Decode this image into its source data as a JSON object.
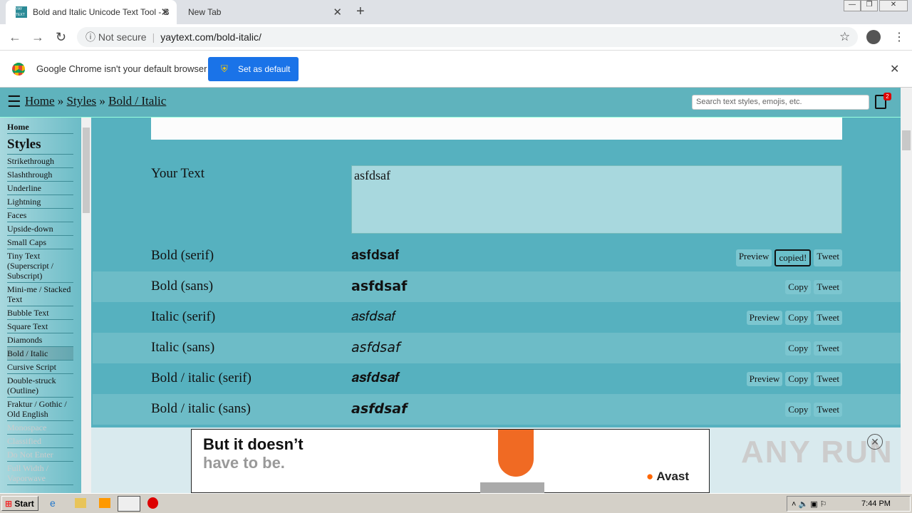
{
  "browser": {
    "tabs": [
      {
        "title": "Bold and Italic Unicode Text Tool - B",
        "favicon": "YAY TEXT"
      },
      {
        "title": "New Tab"
      }
    ],
    "security": "Not secure",
    "url": "yaytext.com/bold-italic/",
    "infobar": {
      "message": "Google Chrome isn't your default browser",
      "button": "Set as default"
    }
  },
  "site": {
    "breadcrumb": [
      "Home",
      "Styles",
      "Bold / Italic"
    ],
    "separator": "»",
    "search_placeholder": "Search text styles, emojis, etc.",
    "clipboard_count": "2"
  },
  "sidebar": {
    "home": "Home",
    "heading": "Styles",
    "items": [
      "Strikethrough",
      "Slashthrough",
      "Underline",
      "Lightning",
      "Faces",
      "Upside-down",
      "Small Caps",
      "Tiny Text (Superscript / Subscript)",
      "Mini-me / Stacked Text",
      "Bubble Text",
      "Square Text",
      "Diamonds",
      "Bold / Italic",
      "Cursive Script",
      "Double-struck (Outline)",
      "Fraktur / Gothic / Old English",
      "Monospace",
      "Classified",
      "Do Not Enter",
      "Full Width / Vaporwave"
    ],
    "active": "Bold / Italic"
  },
  "main": {
    "your_text_label": "Your Text",
    "your_text_value": "asfdsaf",
    "rows": [
      {
        "label": "Bold (serif)",
        "value": "𝐚𝐬𝐟𝐝𝐬𝐚𝐟",
        "buttons": [
          "Preview",
          "copied!",
          "Tweet"
        ]
      },
      {
        "label": "Bold (sans)",
        "value": "𝗮𝘀𝗳𝗱𝘀𝗮𝗳",
        "buttons": [
          "Copy",
          "Tweet"
        ]
      },
      {
        "label": "Italic (serif)",
        "value": "𝑎𝑠𝑓𝑑𝑠𝑎𝑓",
        "buttons": [
          "Preview",
          "Copy",
          "Tweet"
        ]
      },
      {
        "label": "Italic (sans)",
        "value": "𝘢𝘴𝘧𝘥𝘴𝘢𝘧",
        "buttons": [
          "Copy",
          "Tweet"
        ]
      },
      {
        "label": "Bold / italic (serif)",
        "value": "𝒂𝒔𝒇𝒅𝒔𝒂𝒇",
        "buttons": [
          "Preview",
          "Copy",
          "Tweet"
        ]
      },
      {
        "label": "Bold / italic (sans)",
        "value": "𝙖𝙨𝙛𝙙𝙨𝙖𝙛",
        "buttons": [
          "Copy",
          "Tweet"
        ]
      }
    ]
  },
  "ad": {
    "line1": "But it doesn’t",
    "line2": "have to be.",
    "brand": "Avast"
  },
  "watermark": "ANY RUN",
  "taskbar": {
    "start": "Start",
    "time": "7:44 PM"
  }
}
